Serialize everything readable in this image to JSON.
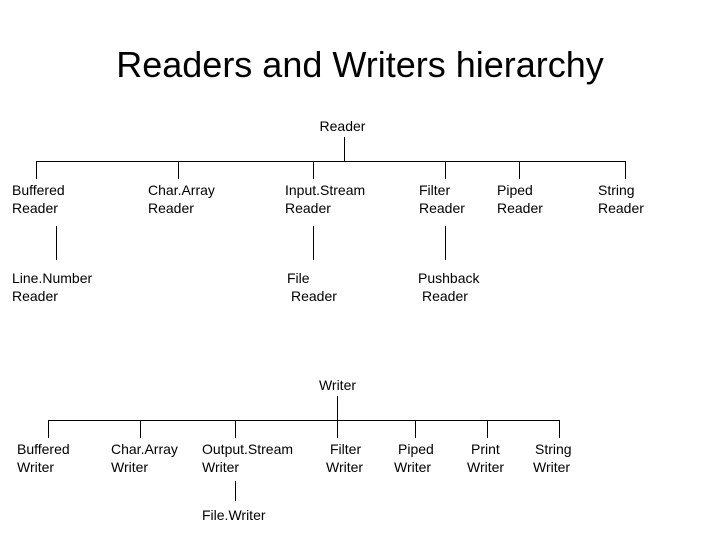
{
  "slide": {
    "title": "Readers and Writers hierarchy",
    "background_color": "#ffffff",
    "line_color": "#000000",
    "text_color": "#000000"
  },
  "reader_tree": {
    "root": "Reader",
    "children": [
      {
        "line1": "Buffered",
        "line2": "Reader"
      },
      {
        "line1": "Char.Array",
        "line2": "Reader"
      },
      {
        "line1": "Input.Stream",
        "line2": "Reader"
      },
      {
        "line1": "Filter",
        "line2": "Reader"
      },
      {
        "line1": "Piped",
        "line2": "Reader"
      },
      {
        "line1": "String",
        "line2": "Reader"
      }
    ],
    "grandchildren": [
      {
        "line1": "Line.Number",
        "line2": "Reader"
      },
      {
        "line1": "File",
        "line2": "Reader"
      },
      {
        "line1": "Pushback",
        "line2": "Reader"
      }
    ]
  },
  "writer_tree": {
    "root": "Writer",
    "children": [
      {
        "line1": "Buffered",
        "line2": "Writer"
      },
      {
        "line1": "Char.Array",
        "line2": "Writer"
      },
      {
        "line1": "Output.Stream",
        "line2": "Writer"
      },
      {
        "line1": "Filter",
        "line2": "Writer"
      },
      {
        "line1": "Piped",
        "line2": "Writer"
      },
      {
        "line1": "Print",
        "line2": "Writer"
      },
      {
        "line1": "String",
        "line2": "Writer"
      }
    ],
    "grandchildren": [
      {
        "line1": "File.Writer",
        "line2": ""
      }
    ]
  }
}
